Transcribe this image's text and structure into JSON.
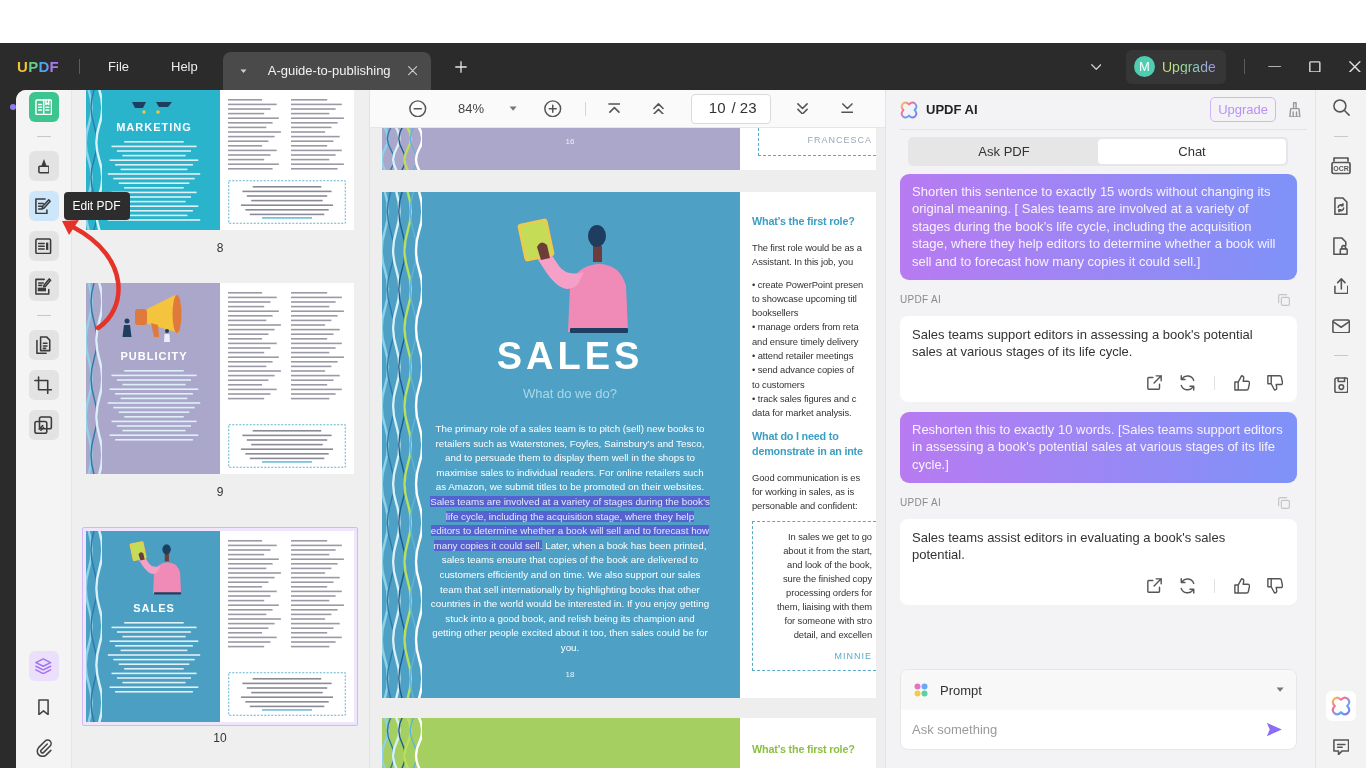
{
  "window": {
    "app_name": "UPDF",
    "menus": [
      "File",
      "Help"
    ],
    "tabs": [
      {
        "title": "A-guide-to-publishing",
        "selected": true
      }
    ],
    "account": {
      "avatar": "M",
      "label": "Upgrade"
    }
  },
  "left_toolbar": {
    "groups": [
      [
        {
          "kind": "reader",
          "selected": true,
          "hovered": false
        }
      ],
      [
        {
          "kind": "comment",
          "selected": false,
          "hovered": false
        },
        {
          "kind": "edit",
          "selected": false,
          "hovered": true,
          "tooltip": "Edit PDF"
        },
        {
          "kind": "form",
          "selected": false,
          "hovered": false
        },
        {
          "kind": "sign",
          "selected": false,
          "hovered": false
        }
      ],
      [
        {
          "kind": "organize",
          "selected": false,
          "hovered": false
        },
        {
          "kind": "crop",
          "selected": false,
          "hovered": false
        },
        {
          "kind": "tools",
          "selected": false,
          "hovered": false
        }
      ]
    ],
    "bottom": [
      {
        "kind": "thumbnails",
        "selected": true
      },
      {
        "kind": "bookmarks",
        "selected": false
      },
      {
        "kind": "attachments",
        "selected": false
      }
    ]
  },
  "thumbnails": [
    {
      "page": "8",
      "title": "MARKETING",
      "illustration": {
        "kind": "figures"
      },
      "color": "#2ab4cb",
      "cropped": true,
      "selected": false
    },
    {
      "page": "9",
      "title": "PUBLICITY",
      "illustration": {
        "kind": "megaphone"
      },
      "color": "#aaa7cb",
      "cropped": false,
      "selected": false
    },
    {
      "page": "10",
      "title": "SALES",
      "illustration": {
        "kind": "reader"
      },
      "color": "#4a9fc3",
      "cropped": false,
      "selected": true
    }
  ],
  "viewer": {
    "zoom": "84%",
    "page": "10",
    "page_total": "/ 23",
    "pages": [
      {
        "kind": "partial_top",
        "color": "#aaa7cb",
        "number": "16",
        "quote_author": "FRANCESCA"
      },
      {
        "kind": "full",
        "color": "#4ea1c5",
        "illustration": {
          "kind": "reader"
        },
        "title": "SALES",
        "subtitle": "What do we do?",
        "paragraph": [
          {
            "text": "The primary role of a sales team is to pitch (sell) new books to retailers such as Waterstones, Foyles, Sainsbury’s and Tesco, and to persuade them to display them well in the shops to maximise sales to individual readers. For online retailers such as Amazon, we submit titles to be promoted on their websites. ",
            "highlighted": false
          },
          {
            "text": "Sales teams are involved at a variety of stages during the book’s life cycle, including the acquisition stage, where they help editors to determine whether a book will sell and to forecast how many copies it could sell.",
            "highlighted": true
          },
          {
            "text": " Later, when a book has been printed, sales teams ensure that copies of the book are delivered to customers efficiently and on time. We also support our sales team that sell internationally by highlighting books that other countries in the world would be interested in. If you enjoy getting stuck into a good book, and relish being its champion and getting other people excited about it too, then sales could be for you.",
            "highlighted": false
          }
        ],
        "number": "18",
        "side": [
          {
            "kind": "heading",
            "lines": [
              "What’s the first role?"
            ]
          },
          {
            "kind": "text",
            "lines": [
              "The first role would be as a",
              "Assistant. In this job, you"
            ]
          },
          {
            "kind": "text",
            "lines": [
              "• create PowerPoint presen",
              "to showcase upcoming titl",
              "booksellers",
              "• manage orders from reta",
              "and ensure timely delivery",
              "• attend retailer meetings",
              "• send advance copies of",
              "to customers",
              "• track sales figures and c",
              "data for market analysis."
            ]
          },
          {
            "kind": "heading",
            "lines": [
              "What do I need to",
              "demonstrate in an inte"
            ]
          },
          {
            "kind": "text",
            "lines": [
              "Good communication is es",
              "for working in sales, as is",
              "personable and confident:"
            ]
          },
          {
            "kind": "quote",
            "lines": [
              "In sales we get to go",
              "about it from the start,",
              "and look of the book,",
              "sure the finished copy",
              "processing orders for",
              "them, liaising with them",
              "for someone with stro",
              "detail, and excellen"
            ],
            "author": "MINNIE"
          }
        ]
      },
      {
        "kind": "partial_bottom",
        "color": "#a6cf62",
        "heading": "What’s the first role?"
      }
    ]
  },
  "annotations": [
    {
      "kind": "curved_arrow"
    }
  ],
  "ai_panel": {
    "title": "UPDF AI",
    "upgrade": "Upgrade",
    "tabs": [
      {
        "label": "Ask PDF",
        "selected": false
      },
      {
        "label": "Chat",
        "selected": true
      }
    ],
    "messages": [
      {
        "kind": "user",
        "text": "Shorten this sentence to exactly 15 words without changing its original meaning. [ Sales teams are involved at a variety of stages during the book’s life cycle, including the acquisition stage, where they help editors to determine whether a book will sell and to forecast how many copies it could sell.]"
      },
      {
        "kind": "assistant",
        "sender": "UPDF AI",
        "text": "Sales teams support editors in assessing a book's potential sales at various stages of its life cycle."
      },
      {
        "kind": "user",
        "text": "Reshorten this to exactly 10 words. [Sales teams support editors in assessing a book's potential sales at various stages of its life cycle.]"
      },
      {
        "kind": "assistant",
        "sender": "UPDF AI",
        "text": "Sales teams assist editors in evaluating a book's sales potential."
      }
    ],
    "prompt": {
      "label": "Prompt",
      "placeholder": "Ask something"
    }
  },
  "right_toolbar": {
    "groups": [
      [
        {
          "kind": "search"
        }
      ],
      [
        {
          "kind": "ocr",
          "label": "OCR"
        },
        {
          "kind": "convert"
        },
        {
          "kind": "protect"
        },
        {
          "kind": "share"
        },
        {
          "kind": "email"
        }
      ],
      [
        {
          "kind": "save"
        }
      ]
    ],
    "bottom": [
      {
        "kind": "ai",
        "selected": true
      },
      {
        "kind": "comment",
        "selected": false
      }
    ]
  }
}
